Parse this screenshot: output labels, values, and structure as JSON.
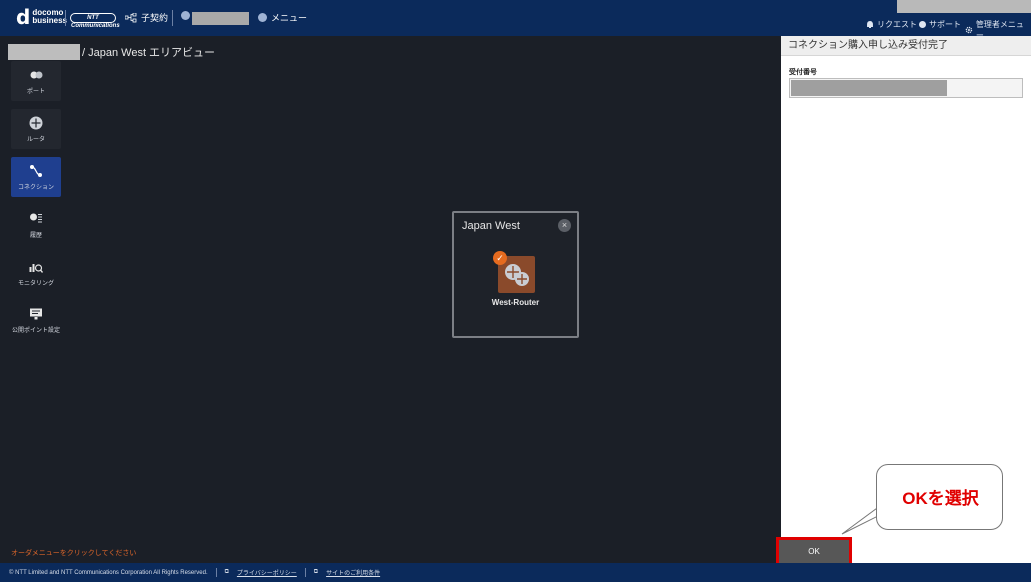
{
  "header": {
    "logo_line1": "docomo",
    "logo_line2": "business",
    "ntt_logo": "NTT Communications",
    "sub_contract": "子契約",
    "menu": "メニュー",
    "request": "リクエスト",
    "support": "サポート",
    "admin_menu": "管理者メニュー"
  },
  "breadcrumb": {
    "rest": "/ Japan West エリアビュー"
  },
  "sidebar": {
    "items": [
      {
        "label": "ポート"
      },
      {
        "label": "ルータ"
      },
      {
        "label": "コネクション"
      },
      {
        "label": "履歴"
      },
      {
        "label": "モニタリング"
      },
      {
        "label": "公開ポイント設定"
      }
    ]
  },
  "dialog": {
    "title": "Japan West",
    "router_label": "West-Router"
  },
  "hint": "オーダメニューをクリックしてください",
  "panel": {
    "title": "コネクション購入申し込み受付完了",
    "field_label": "受付番号",
    "ok_label": "OK"
  },
  "callout": {
    "text": "OKを選択"
  },
  "footer": {
    "copyright": "© NTT Limited and NTT Communications Corporation All Rights Reserved.",
    "privacy": "プライバシーポリシー",
    "terms": "サイトのご利用条件"
  },
  "colors": {
    "header_bg": "#0b2a5b",
    "canvas_bg": "#1b1f27",
    "active_nav": "#1f3f8f",
    "accent_orange": "#e56b1f",
    "annotation_red": "#e00000"
  }
}
